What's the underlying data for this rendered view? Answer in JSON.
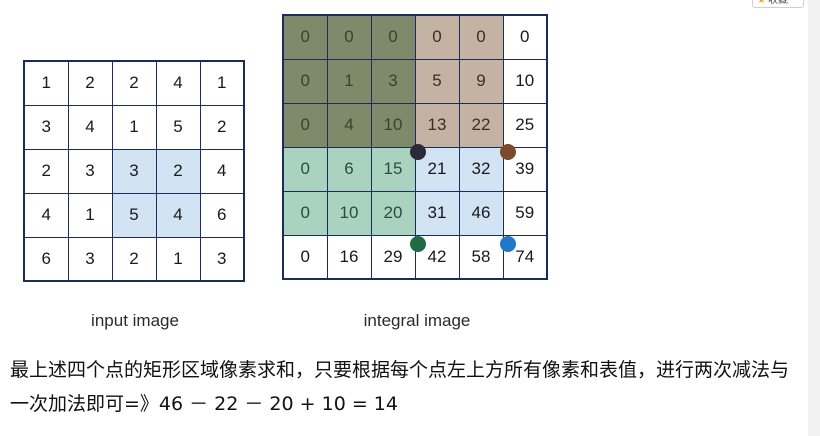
{
  "favorite": {
    "label": "收藏",
    "icon": "star-icon"
  },
  "input_image": {
    "caption": "input image",
    "rows": [
      [
        "1",
        "2",
        "2",
        "4",
        "1"
      ],
      [
        "3",
        "4",
        "1",
        "5",
        "2"
      ],
      [
        "2",
        "3",
        "3",
        "2",
        "4"
      ],
      [
        "4",
        "1",
        "5",
        "4",
        "6"
      ],
      [
        "6",
        "3",
        "2",
        "1",
        "3"
      ]
    ],
    "highlight": {
      "rows": [
        2,
        3
      ],
      "cols": [
        2,
        3
      ],
      "color": "#d2e3f3"
    }
  },
  "integral_image": {
    "caption": "integral image",
    "rows": [
      [
        "0",
        "0",
        "0",
        "0",
        "0",
        "0"
      ],
      [
        "0",
        "1",
        "3",
        "5",
        "9",
        "10"
      ],
      [
        "0",
        "4",
        "10",
        "13",
        "22",
        "25"
      ],
      [
        "0",
        "6",
        "15",
        "21",
        "32",
        "39"
      ],
      [
        "0",
        "10",
        "20",
        "31",
        "46",
        "59"
      ],
      [
        "0",
        "16",
        "29",
        "42",
        "58",
        "74"
      ]
    ],
    "region_colors": {
      "dark_olive": "#7f8a6a",
      "tan": "#c4b2a2",
      "green": "#a9d2bf",
      "light_blue": "#d2e3f3"
    },
    "corner_dots": [
      {
        "name": "top-left",
        "value": "10",
        "color": "#2a2a3a"
      },
      {
        "name": "top-right",
        "value": "22",
        "color": "#7a4a2a"
      },
      {
        "name": "bottom-left",
        "value": "20",
        "color": "#1f6b45"
      },
      {
        "name": "bottom-right",
        "value": "46",
        "color": "#1f78c8"
      }
    ]
  },
  "explanation": "最上述四个点的矩形区域像素求和，只要根据每个点左上方所有像素和表值，进行两次减法与一次加法即可=》46 － 22 － 20 + 10 = 14"
}
